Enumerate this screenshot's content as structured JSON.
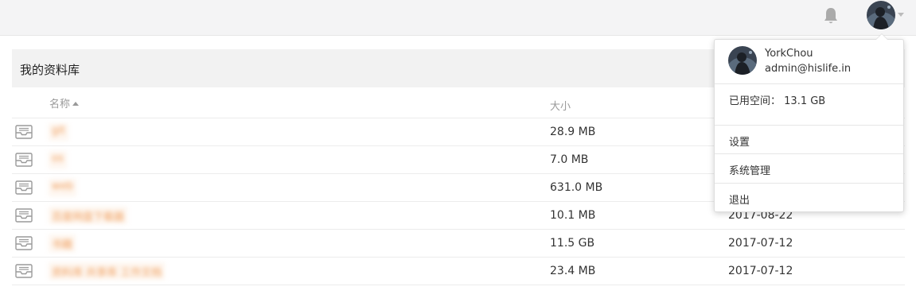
{
  "library": {
    "title": "我的资料库",
    "columns": {
      "name": "名称",
      "size": "大小"
    },
    "rows": [
      {
        "name": "git",
        "size": "28.9 MB",
        "date": ""
      },
      {
        "name": "os",
        "size": "7.0 MB",
        "date": ""
      },
      {
        "name": "web",
        "size": "631.0 MB",
        "date": ""
      },
      {
        "name": "百度网盘下载器",
        "size": "10.1 MB",
        "date": "2017-08-22"
      },
      {
        "name": "书籍",
        "size": "11.5 GB",
        "date": "2017-07-12"
      },
      {
        "name": "资料库 共享库 工作文档",
        "size": "23.4 MB",
        "date": "2017-07-12"
      }
    ]
  },
  "user_menu": {
    "username": "YorkChou",
    "email": "admin@hislife.in",
    "usage_label": "已用空间：",
    "usage_value": "13.1 GB",
    "items": [
      {
        "label": "设置"
      },
      {
        "label": "系统管理"
      },
      {
        "label": "退出"
      }
    ]
  },
  "icons": {
    "notification": "bell-icon",
    "library": "library-icon",
    "avatar": "user-avatar"
  }
}
